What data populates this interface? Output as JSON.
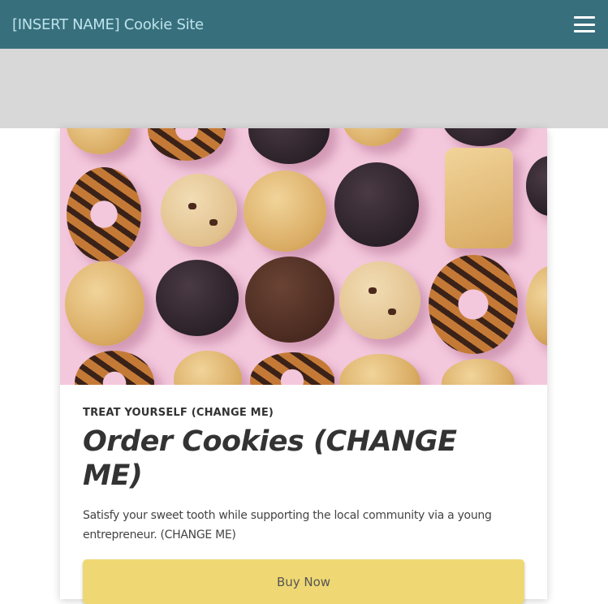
{
  "header": {
    "site_title": "[INSERT NAME] Cookie Site",
    "menu_icon": "hamburger-menu-icon",
    "background_color": "#386f7d"
  },
  "banner": {
    "background_color": "#d8d8d8"
  },
  "card": {
    "image_alt": "cookies-photo",
    "eyebrow": "TREAT YOURSELF (CHANGE ME)",
    "heading": "Order Cookies (CHANGE ME)",
    "description": "Satisfy your sweet tooth while supporting the local community via a young entrepreneur. (CHANGE ME)",
    "button_label": "Buy Now",
    "button_color": "#efd873"
  }
}
